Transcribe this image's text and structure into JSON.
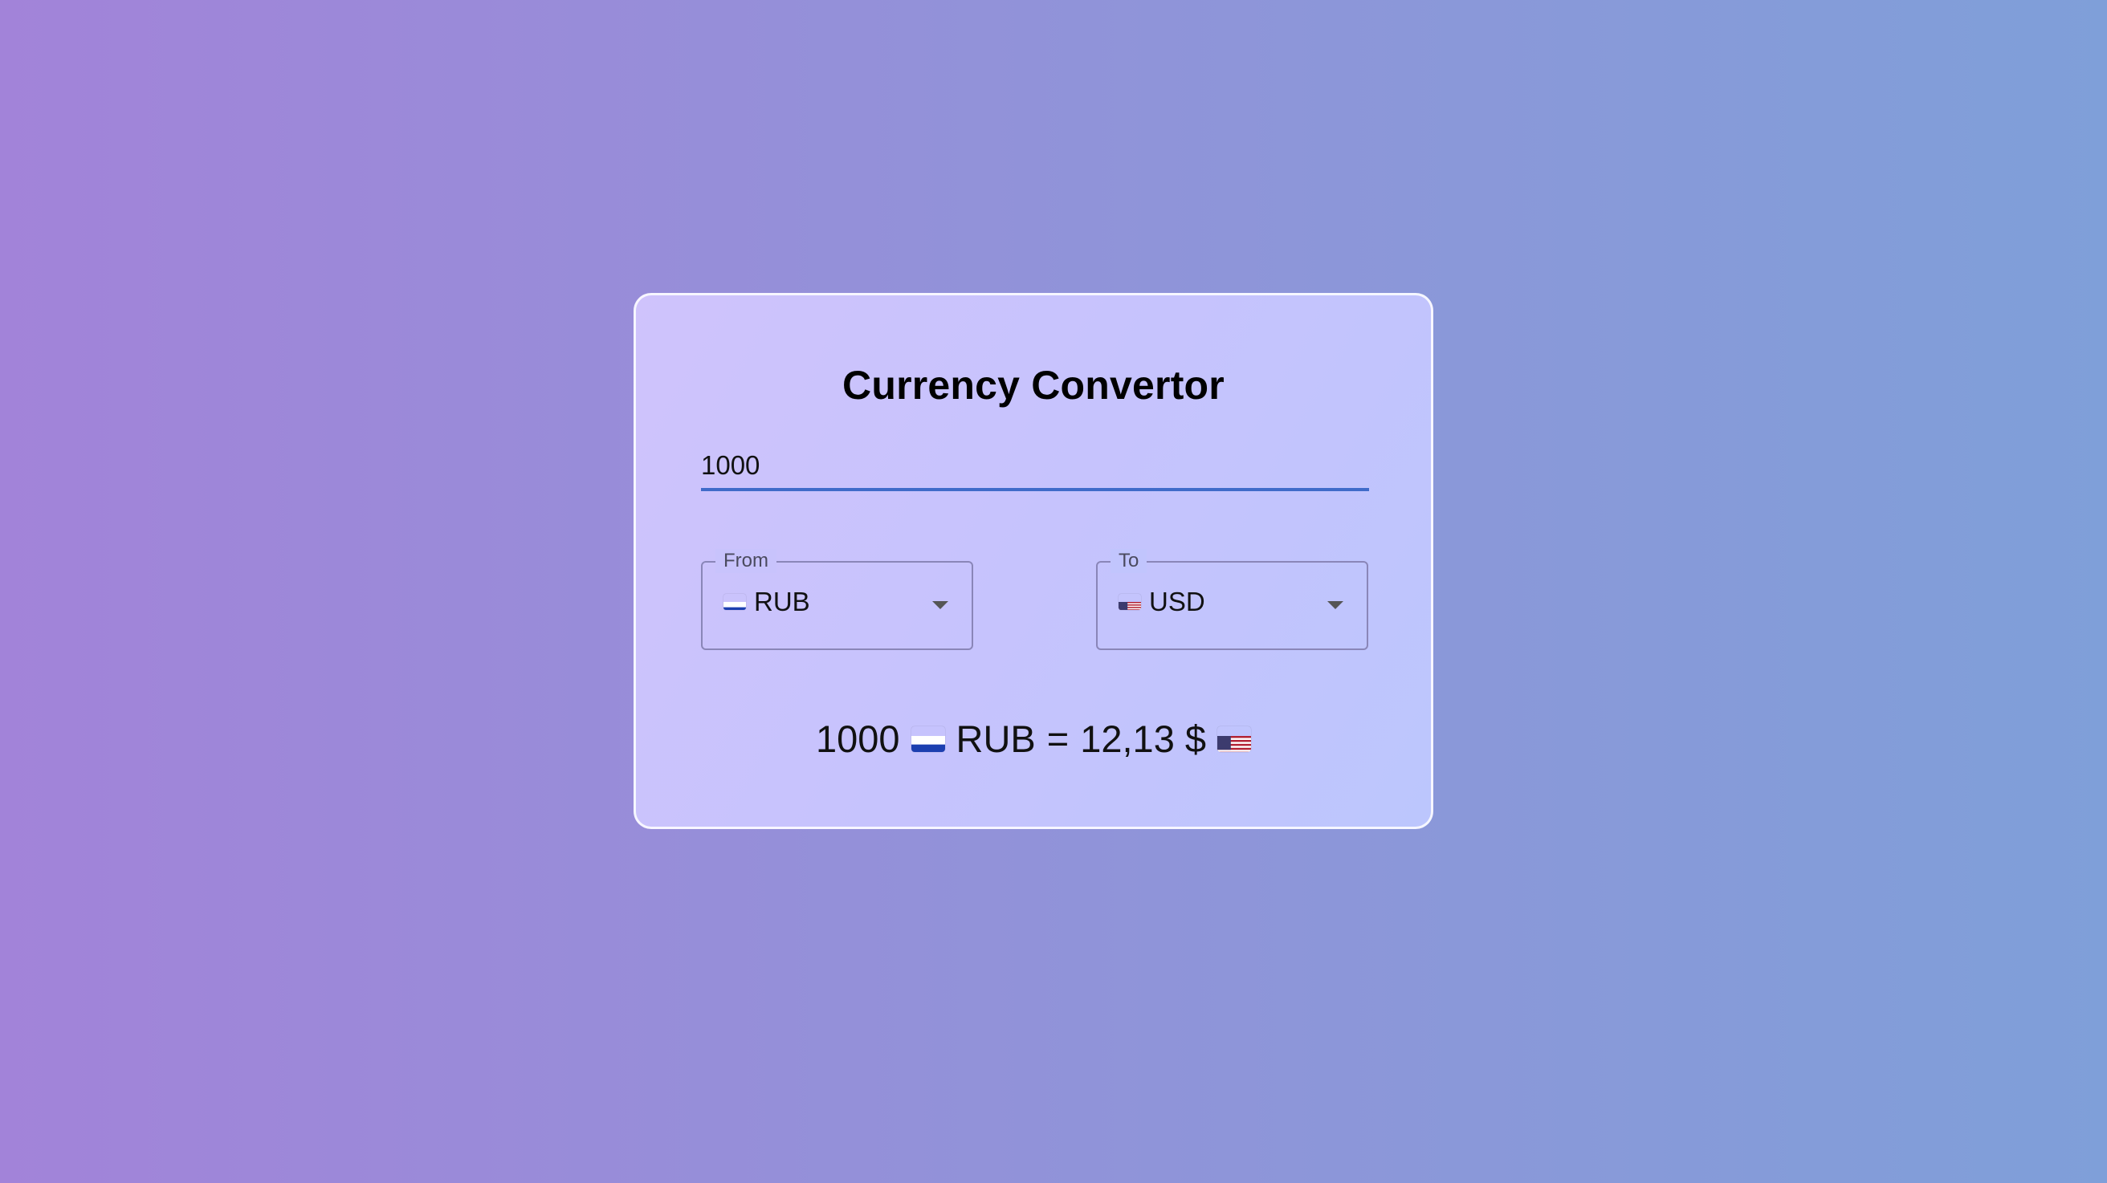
{
  "app": {
    "title": "Currency Convertor"
  },
  "amount": {
    "value": "1000"
  },
  "from": {
    "legend": "From",
    "currency": "RUB",
    "flag_icon": "russia-flag-icon"
  },
  "to": {
    "legend": "To",
    "currency": "USD",
    "flag_icon": "usa-flag-icon"
  },
  "result": {
    "amount": "1000",
    "from_currency": "RUB",
    "equals": "=",
    "converted": "12,13 $"
  },
  "colors": {
    "underline_accent": "#3f6bc9",
    "card_border": "#ffffff",
    "background_left": "#a283d9",
    "background_right": "#7f9fd9"
  }
}
